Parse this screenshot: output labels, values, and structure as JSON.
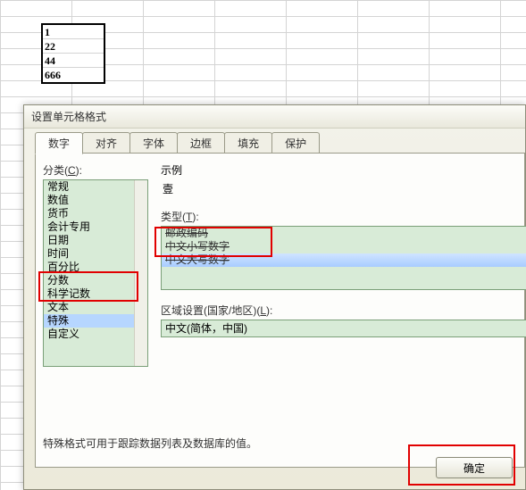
{
  "sheet": {
    "cells": [
      "1",
      "22",
      "44",
      "666"
    ]
  },
  "dialog": {
    "title": "设置单元格格式",
    "tabs": [
      {
        "label": "数字",
        "active": true
      },
      {
        "label": "对齐"
      },
      {
        "label": "字体"
      },
      {
        "label": "边框"
      },
      {
        "label": "填充"
      },
      {
        "label": "保护"
      }
    ],
    "category_label_prefix": "分类(",
    "category_label_key": "C",
    "category_label_suffix": "):",
    "categories": [
      {
        "label": "常规"
      },
      {
        "label": "数值"
      },
      {
        "label": "货币"
      },
      {
        "label": "会计专用"
      },
      {
        "label": "日期"
      },
      {
        "label": "时间"
      },
      {
        "label": "百分比"
      },
      {
        "label": "分数"
      },
      {
        "label": "科学记数"
      },
      {
        "label": "文本"
      },
      {
        "label": "特殊",
        "selected": true
      },
      {
        "label": "自定义"
      }
    ],
    "sample_label": "示例",
    "sample_value": "壹",
    "type_label_prefix": "类型(",
    "type_label_key": "T",
    "type_label_suffix": "):",
    "types": [
      {
        "label": "邮政编码"
      },
      {
        "label": "中文小写数字"
      },
      {
        "label": "中文大写数字",
        "selected": true
      }
    ],
    "locale_label_prefix": "区域设置(国家/地区)(",
    "locale_label_key": "L",
    "locale_label_suffix": "):",
    "locale_value": "中文(简体，中国)",
    "description": "特殊格式可用于跟踪数据列表及数据库的值。",
    "ok_label": "确定"
  }
}
